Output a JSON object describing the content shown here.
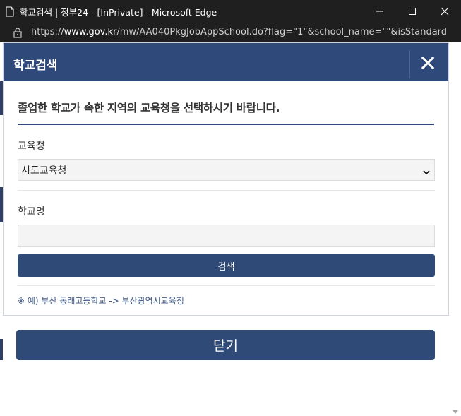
{
  "window": {
    "title": "학교검색 | 정부24 - [InPrivate] - Microsoft Edge",
    "url_scheme": "https://",
    "url_host": "www.gov.kr",
    "url_rest": "/mw/AA040PkgJobAppSchool.do?flag=\"1\"&school_name=\"\"&isStandard..."
  },
  "modal": {
    "title": "학교검색",
    "instruction": "졸업한 학교가 속한 지역의 교육청을 선택하시기 바랍니다.",
    "office_label": "교육청",
    "office_select_value": "시도교육청",
    "school_label": "학교명",
    "school_input_value": "",
    "search_button": "검색",
    "example_text": "※ 예) 부산 동래고등학교 -> 부산광역시교육청"
  },
  "footer": {
    "close_button": "닫기"
  },
  "colors": {
    "header_bg": "#2f4a7a",
    "button_bg": "#304a77",
    "titlebar_bg": "#1f1f1f"
  }
}
